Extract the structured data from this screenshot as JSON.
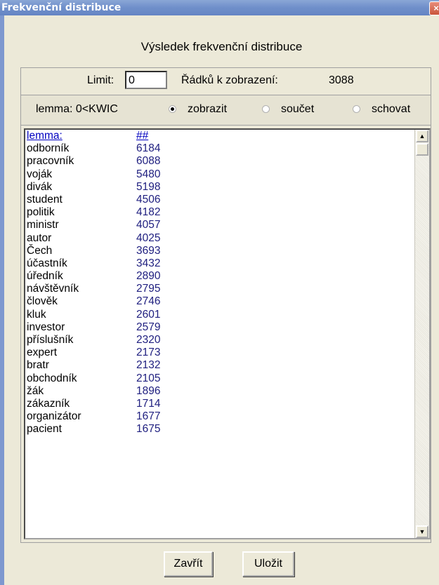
{
  "window": {
    "title": "Frekvenční distribuce",
    "close_label": "×"
  },
  "heading": "Výsledek frekvenční distribuce",
  "limit": {
    "label": "Limit:",
    "value": "0",
    "rows_label": "Řádků k zobrazení:",
    "rows_value": "3088"
  },
  "kwic": {
    "label": "lemma: 0<KWIC",
    "options": [
      {
        "label": "zobrazit",
        "checked": true
      },
      {
        "label": "součet",
        "checked": false
      },
      {
        "label": "schovat",
        "checked": false
      }
    ]
  },
  "list": {
    "header": {
      "lemma": "lemma:",
      "count": "##"
    },
    "rows": [
      {
        "lemma": "odborník",
        "count": "6184"
      },
      {
        "lemma": "pracovník",
        "count": "6088"
      },
      {
        "lemma": "voják",
        "count": "5480"
      },
      {
        "lemma": "divák",
        "count": "5198"
      },
      {
        "lemma": "student",
        "count": "4506"
      },
      {
        "lemma": "politik",
        "count": "4182"
      },
      {
        "lemma": "ministr",
        "count": "4057"
      },
      {
        "lemma": "autor",
        "count": "4025"
      },
      {
        "lemma": "Čech",
        "count": "3693"
      },
      {
        "lemma": "účastník",
        "count": "3432"
      },
      {
        "lemma": "úředník",
        "count": "2890"
      },
      {
        "lemma": "návštěvník",
        "count": "2795"
      },
      {
        "lemma": "člověk",
        "count": "2746"
      },
      {
        "lemma": "kluk",
        "count": "2601"
      },
      {
        "lemma": "investor",
        "count": "2579"
      },
      {
        "lemma": "příslušník",
        "count": "2320"
      },
      {
        "lemma": "expert",
        "count": "2173"
      },
      {
        "lemma": "bratr",
        "count": "2132"
      },
      {
        "lemma": "obchodník",
        "count": "2105"
      },
      {
        "lemma": "žák",
        "count": "1896"
      },
      {
        "lemma": "zákazník",
        "count": "1714"
      },
      {
        "lemma": "organizátor",
        "count": "1677"
      },
      {
        "lemma": "pacient",
        "count": "1675"
      }
    ]
  },
  "buttons": {
    "close": "Zavřít",
    "save": "Uložit"
  },
  "colors": {
    "titlebar": "#6f8fca",
    "link": "#0000c0",
    "count_text": "#202080"
  }
}
